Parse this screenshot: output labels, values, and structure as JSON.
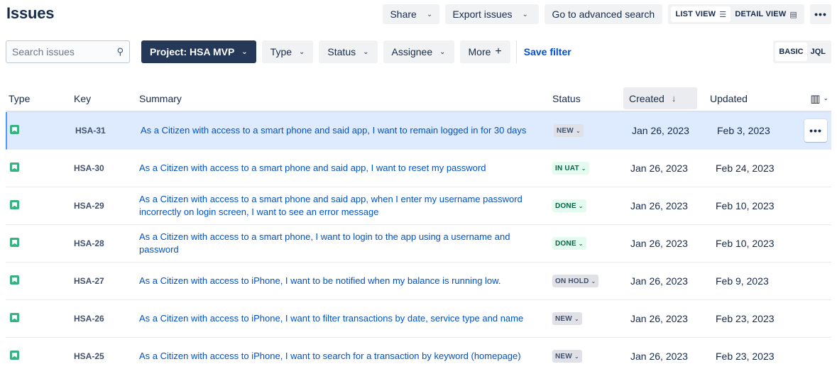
{
  "page": {
    "title": "Issues"
  },
  "top_actions": {
    "share_label": "Share",
    "export_label": "Export issues",
    "advanced_search_label": "Go to advanced search",
    "list_view_label": "LIST VIEW",
    "list_view_icon": "list-icon",
    "detail_view_label": "DETAIL VIEW",
    "detail_view_icon": "detail-icon",
    "more_label": "•••"
  },
  "filters": {
    "search_placeholder": "Search issues",
    "search_value": "",
    "project_label": "Project: HSA MVP",
    "type_label": "Type",
    "status_label": "Status",
    "assignee_label": "Assignee",
    "more_label": "More",
    "save_filter_label": "Save filter",
    "mode_basic": "BASIC",
    "mode_jql": "JQL",
    "active_mode": "BASIC"
  },
  "table": {
    "columns": [
      "Type",
      "Key",
      "Summary",
      "Status",
      "Created",
      "Updated"
    ],
    "sort_column": "Created",
    "rows": [
      {
        "key": "HSA-31",
        "summary": "As a Citizen with access to a smart phone and said app, I want to remain logged in for 30 days",
        "status": "NEW",
        "created": "Jan 26, 2023",
        "updated": "Feb 3, 2023"
      },
      {
        "key": "HSA-30",
        "summary": "As a Citizen with access to a smart phone and said app, I want to reset my password",
        "status": "IN UAT",
        "created": "Jan 26, 2023",
        "updated": "Feb 24, 2023"
      },
      {
        "key": "HSA-29",
        "summary": "As a Citizen with access to a smart phone and said app, when I enter my username password incorrectly on login screen, I want to see an error message",
        "status": "DONE",
        "created": "Jan 26, 2023",
        "updated": "Feb 10, 2023"
      },
      {
        "key": "HSA-28",
        "summary": "As a Citizen with access to a smart phone, I want to login to the app using a username and password",
        "status": "DONE",
        "created": "Jan 26, 2023",
        "updated": "Feb 10, 2023"
      },
      {
        "key": "HSA-27",
        "summary": "As a Citizen with access to iPhone, I want to be notified when my balance is running low.",
        "status": "ON HOLD",
        "created": "Jan 26, 2023",
        "updated": "Feb 9, 2023"
      },
      {
        "key": "HSA-26",
        "summary": "As a Citizen with access to iPhone, I want to filter transactions by date, service type and name",
        "status": "NEW",
        "created": "Jan 26, 2023",
        "updated": "Feb 23, 2023"
      },
      {
        "key": "HSA-25",
        "summary": "As a Citizen with access to iPhone, I want to search for a transaction by keyword (homepage)",
        "status": "NEW",
        "created": "Jan 26, 2023",
        "updated": "Feb 23, 2023"
      }
    ],
    "row_more_label": "•••"
  },
  "colors": {
    "link": "#0052cc",
    "project_button_bg": "#253858",
    "selected_row_bg": "#deebff",
    "story_icon": "#36b37e",
    "done_bg": "#e3fcef",
    "done_text": "#006644"
  }
}
